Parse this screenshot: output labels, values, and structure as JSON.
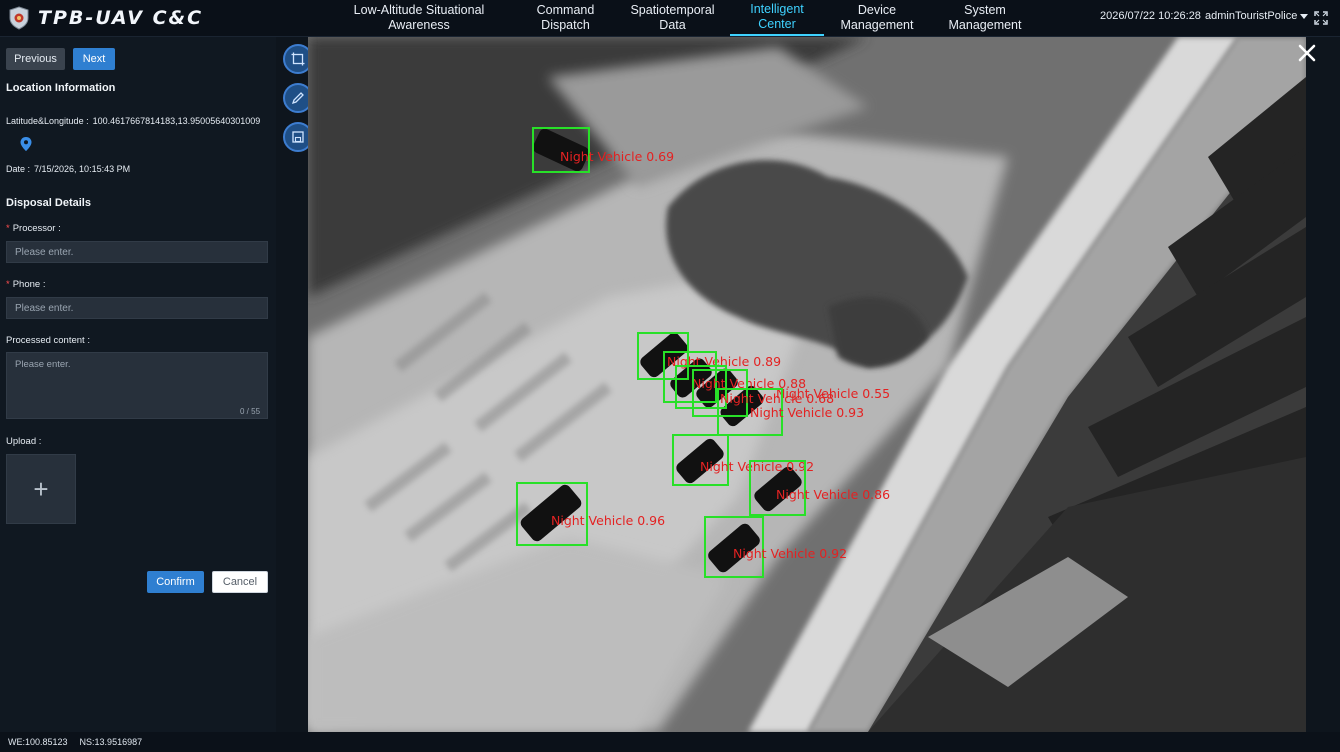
{
  "header": {
    "title": "TPB-UAV C&C",
    "nav": [
      {
        "label": "Low-Altitude Situational\nAwareness",
        "active": false
      },
      {
        "label": "Command\nDispatch",
        "active": false
      },
      {
        "label": "Spatiotemporal\nData",
        "active": false
      },
      {
        "label": "Intelligent\nCenter",
        "active": true
      },
      {
        "label": "Device\nManagement",
        "active": false
      },
      {
        "label": "System\nManagement",
        "active": false
      }
    ],
    "datetime": "2026/07/22 10:26:28",
    "user": "adminTouristPolice"
  },
  "panel": {
    "prev_label": "Previous",
    "next_label": "Next",
    "location_title": "Location Information",
    "latlng_label": "Latitude&Longitude :",
    "latlng_value": "100.4617667814183,13.95005640301009",
    "date_label": "Date :",
    "date_value": "7/15/2026, 10:15:43 PM",
    "disposal_title": "Disposal Details",
    "processor_label": "Processor :",
    "processor_placeholder": "Please enter.",
    "phone_label": "Phone :",
    "phone_placeholder": "Please enter.",
    "content_label": "Processed content :",
    "content_placeholder": "Please enter.",
    "content_counter": "0 / 55",
    "upload_label": "Upload :",
    "confirm_label": "Confirm",
    "cancel_label": "Cancel"
  },
  "tools": [
    {
      "icon": "crop-icon"
    },
    {
      "icon": "pen-icon"
    },
    {
      "icon": "save-icon"
    }
  ],
  "detections": [
    {
      "label": "Night Vehicle 0.69"
    },
    {
      "label": "Night Vehicle 0.89"
    },
    {
      "label": "Night Vehicle 0.88"
    },
    {
      "label": "Night Vehicle 0.55"
    },
    {
      "label": "Night Vehicle 0.68"
    },
    {
      "label": "Night Vehicle 0.93"
    },
    {
      "label": "Night Vehicle 0.92"
    },
    {
      "label": "Night Vehicle 0.86"
    },
    {
      "label": "Night Vehicle 0.96"
    },
    {
      "label": "Night Vehicle 0.92"
    }
  ],
  "status": {
    "we": "WE:100.85123",
    "ns": "NS:13.9516987"
  },
  "colors": {
    "accent": "#3fd2ff",
    "primary_button": "#2f7fd1",
    "detection_box": "#28e028",
    "detection_text": "#e32222"
  }
}
